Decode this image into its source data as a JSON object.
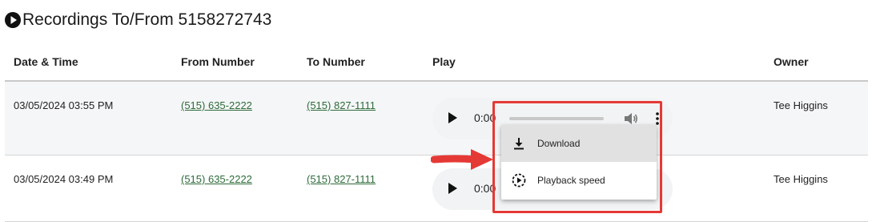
{
  "page": {
    "title": "Recordings To/From 5158272743"
  },
  "table": {
    "columns": [
      "Date & Time",
      "From Number",
      "To Number",
      "Play",
      "Owner"
    ],
    "rows": [
      {
        "date_time": "03/05/2024 03:55 PM",
        "from": "(515) 635-2222",
        "to": "(515) 827-1111",
        "time": "0:00",
        "owner": "Tee Higgins"
      },
      {
        "date_time": "03/05/2024 03:49 PM",
        "from": "(515) 635-2222",
        "to": "(515) 827-1111",
        "time": "0:00",
        "owner": "Tee Higgins"
      }
    ]
  },
  "player_menu": {
    "items": [
      {
        "label": "Download",
        "icon": "download-icon"
      },
      {
        "label": "Playback speed",
        "icon": "playback-speed-icon"
      }
    ]
  },
  "colors": {
    "link": "#2e6b3a",
    "highlight": "#e53935",
    "row_alt": "#f5f6f8",
    "menu_hover": "#e1e1e1"
  }
}
